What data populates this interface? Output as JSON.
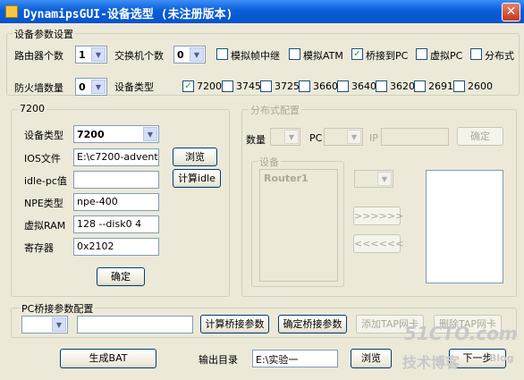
{
  "window": {
    "title": "DynamipsGUI-设备选型 (未注册版本)",
    "close_symbol": "✕"
  },
  "device_params": {
    "group_title": "设备参数设置",
    "router_count_label": "路由器个数",
    "router_count_value": "1",
    "switch_count_label": "交换机个数",
    "switch_count_value": "0",
    "frame_relay_label": "模拟帧中继",
    "frame_relay_checked": false,
    "atm_label": "模拟ATM",
    "atm_checked": false,
    "bridge_pc_label": "桥接到PC",
    "bridge_pc_checked": true,
    "virtual_pc_label": "虚拟PC",
    "virtual_pc_checked": false,
    "distributed_label": "分布式",
    "distributed_checked": false,
    "firewall_count_label": "防火墙数量",
    "firewall_count_value": "0",
    "device_type_label": "设备类型",
    "models": [
      {
        "name": "7200",
        "checked": true
      },
      {
        "name": "3745",
        "checked": false
      },
      {
        "name": "3725",
        "checked": false
      },
      {
        "name": "3660",
        "checked": false
      },
      {
        "name": "3640",
        "checked": false
      },
      {
        "name": "3620",
        "checked": false
      },
      {
        "name": "2691",
        "checked": false
      },
      {
        "name": "2600",
        "checked": false
      }
    ]
  },
  "panel_7200": {
    "group_title": "7200",
    "device_type_label": "设备类型",
    "device_type_value": "7200",
    "ios_label": "IOS文件",
    "ios_value": "E:\\c7200-adventer",
    "browse_label": "浏览",
    "idle_pc_label": "idle-pc值",
    "idle_pc_value": "",
    "calc_idle_label": "计算idle",
    "npe_label": "NPE类型",
    "npe_value": "npe-400",
    "ram_label": "虚拟RAM",
    "ram_value": "128 --disk0 4",
    "register_label": "寄存器",
    "register_value": "0x2102",
    "ok_label": "确定"
  },
  "distributed": {
    "group_title": "分布式配置",
    "count_label": "数量",
    "pc_label": "PC",
    "ip_label": "IP",
    "ok_label": "确定",
    "device_group_title": "设备",
    "device_items": [
      "Router1"
    ],
    "move_right_label": ">>>>>>",
    "move_left_label": "<<<<<<"
  },
  "pc_bridge": {
    "group_title": "PC桥接参数配置",
    "interface_value": "",
    "param_value": "",
    "calc_label": "计算桥接参数",
    "confirm_label": "确定桥接参数",
    "add_tap_label": "添加TAP网卡",
    "del_tap_label": "删除TAP网卡"
  },
  "footer": {
    "generate_bat_label": "生成BAT",
    "output_dir_label": "输出目录",
    "output_dir_value": "E:\\实验一",
    "browse_label": "浏览",
    "next_label": "下一步"
  },
  "watermark": {
    "line1": "51CTO.com",
    "line2": "技术博客",
    "line3": "Blog"
  }
}
